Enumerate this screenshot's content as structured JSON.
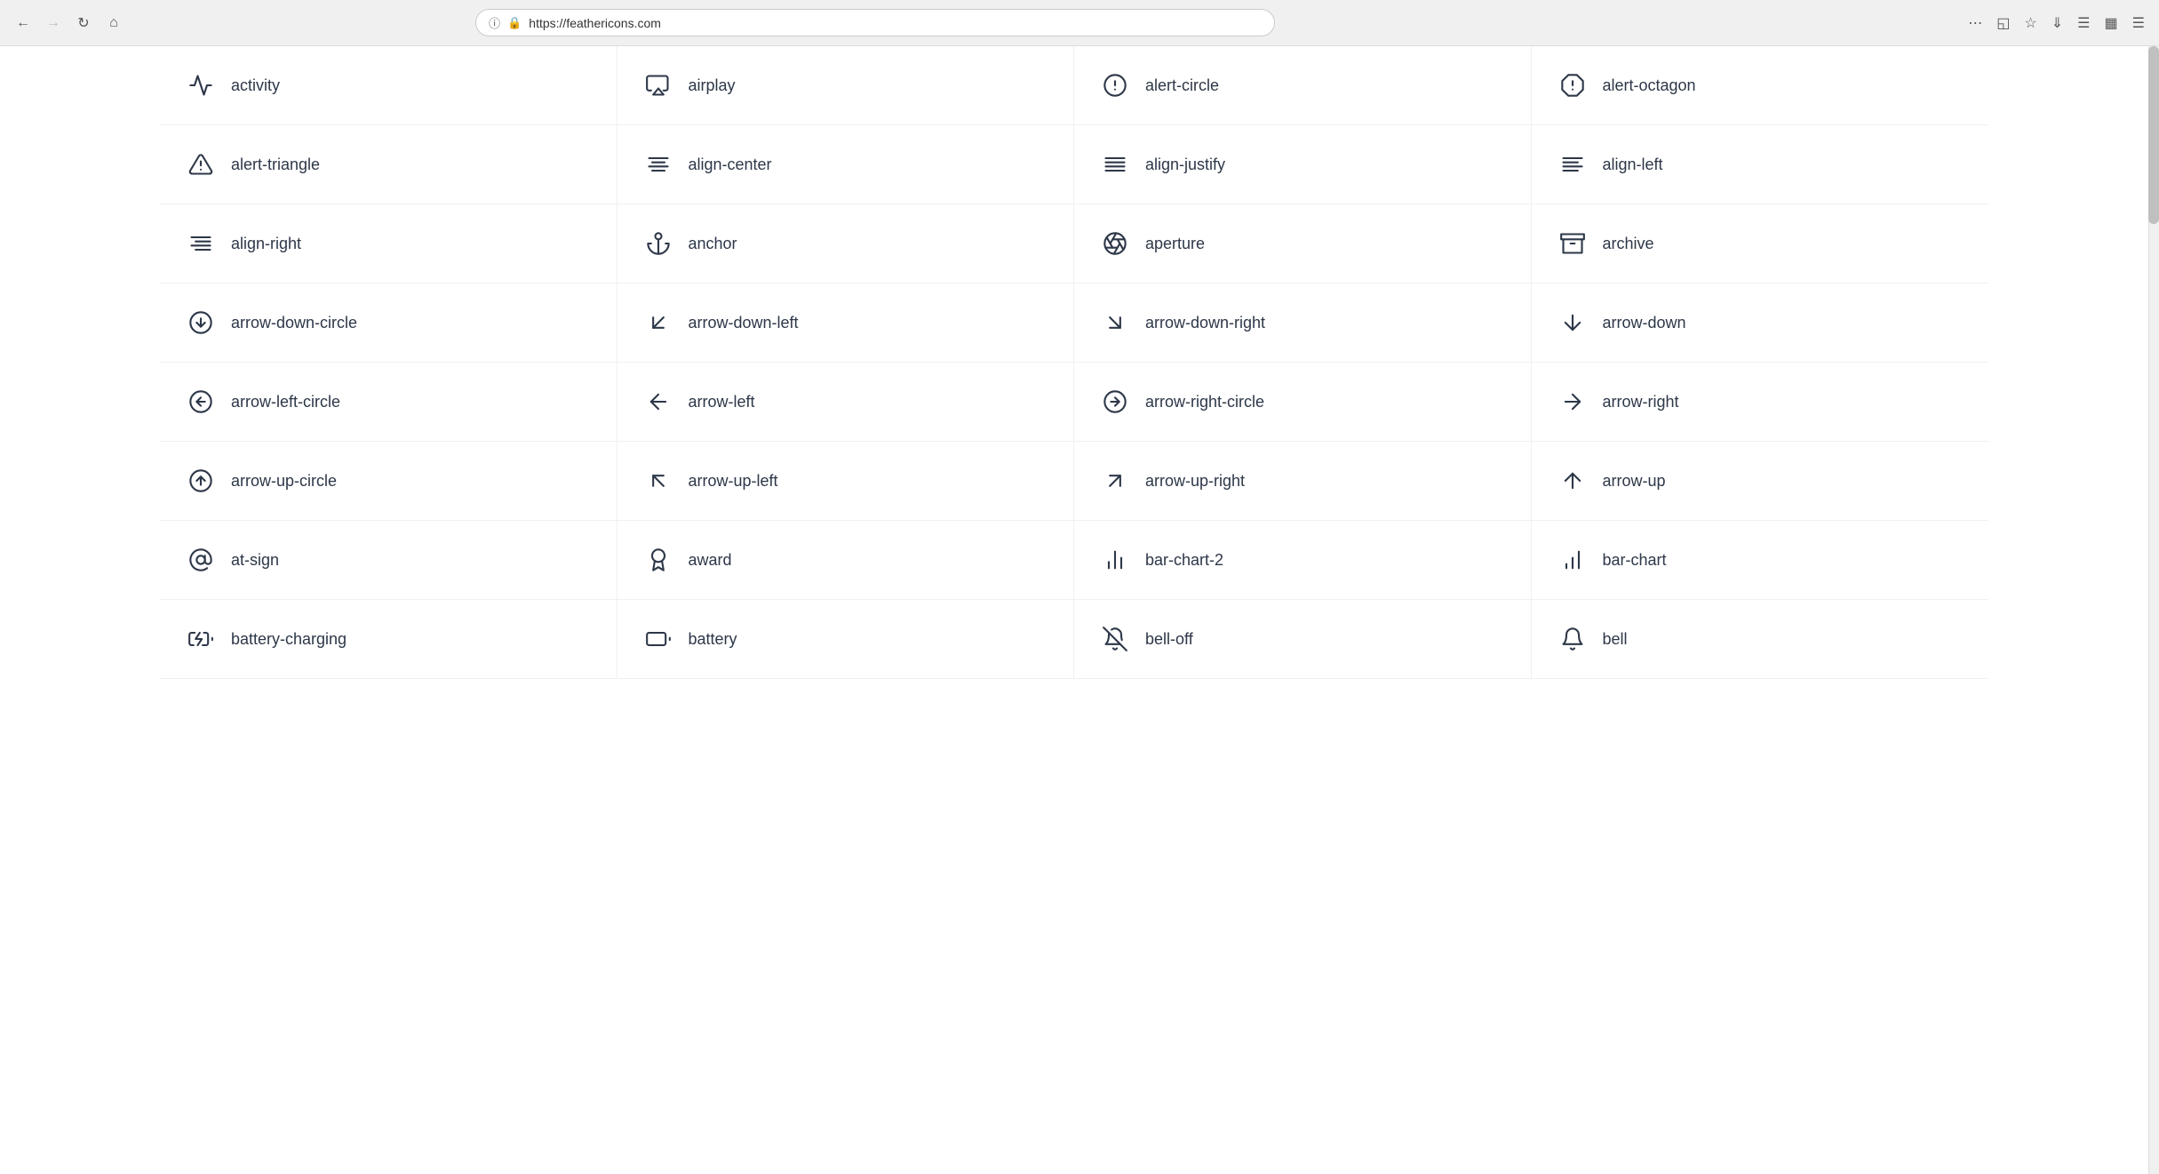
{
  "browser": {
    "url": "https://feathericons.com",
    "back_btn": "←",
    "forward_btn": "→",
    "refresh_btn": "↻",
    "home_btn": "⌂"
  },
  "icons": [
    {
      "name": "activity",
      "type": "activity"
    },
    {
      "name": "airplay",
      "type": "airplay"
    },
    {
      "name": "alert-circle",
      "type": "alert-circle"
    },
    {
      "name": "alert-octagon",
      "type": "alert-octagon"
    },
    {
      "name": "alert-triangle",
      "type": "alert-triangle"
    },
    {
      "name": "align-center",
      "type": "align-center"
    },
    {
      "name": "align-justify",
      "type": "align-justify"
    },
    {
      "name": "align-left",
      "type": "align-left"
    },
    {
      "name": "align-right",
      "type": "align-right"
    },
    {
      "name": "anchor",
      "type": "anchor"
    },
    {
      "name": "aperture",
      "type": "aperture"
    },
    {
      "name": "archive",
      "type": "archive"
    },
    {
      "name": "arrow-down-circle",
      "type": "arrow-down-circle"
    },
    {
      "name": "arrow-down-left",
      "type": "arrow-down-left"
    },
    {
      "name": "arrow-down-right",
      "type": "arrow-down-right"
    },
    {
      "name": "arrow-down",
      "type": "arrow-down"
    },
    {
      "name": "arrow-left-circle",
      "type": "arrow-left-circle"
    },
    {
      "name": "arrow-left",
      "type": "arrow-left"
    },
    {
      "name": "arrow-right-circle",
      "type": "arrow-right-circle"
    },
    {
      "name": "arrow-right",
      "type": "arrow-right"
    },
    {
      "name": "arrow-up-circle",
      "type": "arrow-up-circle"
    },
    {
      "name": "arrow-up-left",
      "type": "arrow-up-left"
    },
    {
      "name": "arrow-up-right",
      "type": "arrow-up-right"
    },
    {
      "name": "arrow-up",
      "type": "arrow-up"
    },
    {
      "name": "at-sign",
      "type": "at-sign"
    },
    {
      "name": "award",
      "type": "award"
    },
    {
      "name": "bar-chart-2",
      "type": "bar-chart-2"
    },
    {
      "name": "bar-chart",
      "type": "bar-chart"
    },
    {
      "name": "battery-charging",
      "type": "battery-charging"
    },
    {
      "name": "battery",
      "type": "battery"
    },
    {
      "name": "bell-off",
      "type": "bell-off"
    },
    {
      "name": "bell",
      "type": "bell"
    }
  ]
}
